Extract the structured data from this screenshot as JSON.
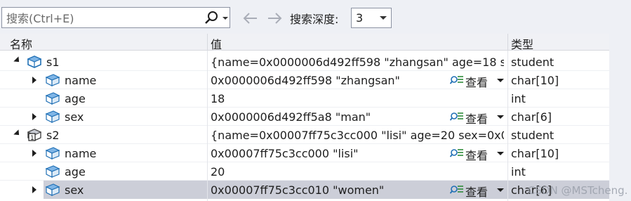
{
  "toolbar": {
    "search_placeholder": "搜索(Ctrl+E)",
    "depth_label": "搜索深度:",
    "depth_value": "3",
    "back_icon": "arrow-left-icon",
    "forward_icon": "arrow-right-icon",
    "search_icon": "magnifier-icon"
  },
  "columns": {
    "name": "名称",
    "value": "值",
    "type": "类型"
  },
  "rows": [
    {
      "name": "s1",
      "value": "{name=0x0000006d492ff598 \"zhangsan\" age=18 s...",
      "type": "student",
      "icon": "struct-icon"
    },
    {
      "name": "name",
      "value": "0x0000006d492ff598 \"zhangsan\"",
      "type": "char[10]",
      "view": "查看",
      "icon": "field-icon"
    },
    {
      "name": "age",
      "value": "18",
      "type": "int",
      "icon": "field-icon"
    },
    {
      "name": "sex",
      "value": "0x0000006d492ff5a8 \"man\"",
      "type": "char[6]",
      "view": "查看",
      "icon": "field-icon"
    },
    {
      "name": "s2",
      "value": "{name=0x00007ff75c3cc000 \"lisi\" age=20 sex=0x00...",
      "type": "student",
      "icon": "struct-pinned-icon"
    },
    {
      "name": "name",
      "value": "0x00007ff75c3cc000 \"lisi\"",
      "type": "char[10]",
      "view": "查看",
      "icon": "field-icon"
    },
    {
      "name": "age",
      "value": "20",
      "type": "int",
      "icon": "field-icon"
    },
    {
      "name": "sex",
      "value": "0x00007ff75c3cc010 \"women\"",
      "type": "char[6]",
      "view": "查看",
      "icon": "field-icon"
    }
  ],
  "watermark": "CSDN @MSTcheng.",
  "colors": {
    "background": "#eef0f5",
    "selected_row": "#ccced8",
    "icon_blue": "#1f6fb5"
  }
}
